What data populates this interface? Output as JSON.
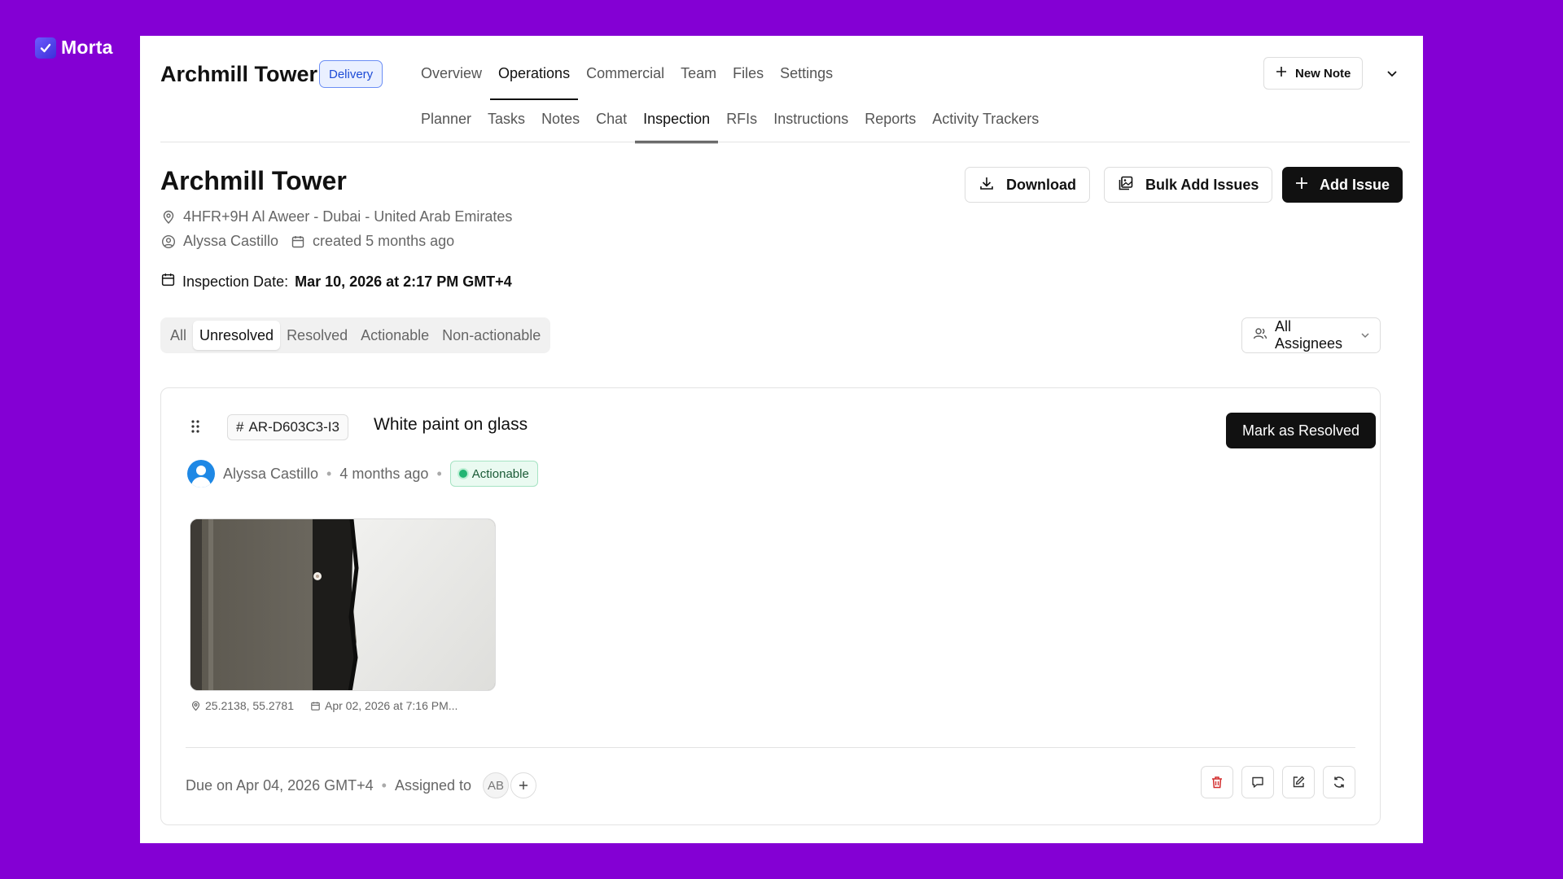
{
  "brand": {
    "name": "Morta"
  },
  "header": {
    "project_title": "Archmill Tower",
    "stage_badge": "Delivery",
    "top_tabs": [
      "Overview",
      "Operations",
      "Commercial",
      "Team",
      "Files",
      "Settings"
    ],
    "sub_tabs": [
      "Planner",
      "Tasks",
      "Notes",
      "Chat",
      "Inspection",
      "RFIs",
      "Instructions",
      "Reports",
      "Activity Trackers"
    ],
    "new_note_label": "New Note"
  },
  "page": {
    "title": "Archmill Tower",
    "location": "4HFR+9H Al Aweer - Dubai - United Arab Emirates",
    "author": "Alyssa Castillo",
    "created": "created 5 months ago",
    "inspection_date_label": "Inspection Date:",
    "inspection_date_value": "Mar 10, 2026 at 2:17 PM GMT+4",
    "buttons": {
      "download": "Download",
      "bulk_add": "Bulk Add Issues",
      "add_issue": "Add Issue"
    }
  },
  "filters": {
    "tabs": [
      "All",
      "Unresolved",
      "Resolved",
      "Actionable",
      "Non-actionable"
    ],
    "active": "Unresolved",
    "assignees_label": "All Assignees"
  },
  "issue": {
    "id": "AR-D603C3-I3",
    "title": "White paint on glass",
    "resolve_label": "Mark as Resolved",
    "author": "Alyssa Castillo",
    "time": "4 months ago",
    "status": "Actionable",
    "photo": {
      "coords": "25.2138, 55.2781",
      "date": "Apr 02, 2026 at 7:16 PM..."
    },
    "due": "Due on Apr 04, 2026 GMT+4",
    "assigned_label": "Assigned to",
    "assignee_initials": "AB"
  },
  "colors": {
    "background": "#8400d4",
    "status_green": "#22b573",
    "delete_red": "#d32f2f"
  }
}
